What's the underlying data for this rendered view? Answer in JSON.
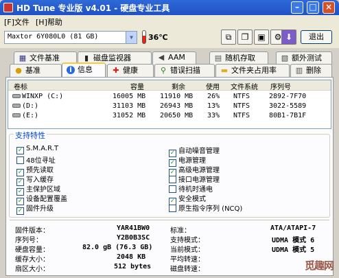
{
  "window": {
    "title": "HD Tune 专业版 v4.01 - 硬盘专业工具",
    "minimize": "–",
    "maximize": "□",
    "close": "×"
  },
  "menu": {
    "file": "[F]文件",
    "help": "[H]帮助"
  },
  "toolbar": {
    "drive": "Maxtor 6Y080L0 (81 GB)",
    "temperature": "36℃",
    "exit_label": "退出",
    "icons": [
      "copy-icon",
      "copy-text-icon",
      "save-icon",
      "options-icon",
      "download-icon"
    ]
  },
  "tabs_top": [
    {
      "label": "文件基准",
      "icon": "file-benchmark-icon",
      "glyph": "▦"
    },
    {
      "label": "磁盘监视器",
      "icon": "disk-monitor-icon",
      "glyph": "▮"
    },
    {
      "label": "AAM",
      "icon": "speaker-icon",
      "glyph": "◀"
    },
    {
      "label": "随机存取",
      "icon": "random-access-icon",
      "glyph": "▤"
    },
    {
      "label": "额外测试",
      "icon": "extra-tests-icon",
      "glyph": "▧"
    }
  ],
  "tabs_bottom": [
    {
      "label": "基准",
      "icon": "benchmark-icon",
      "glyph": "●"
    },
    {
      "label": "信息",
      "icon": "info-icon",
      "glyph": "i"
    },
    {
      "label": "健康",
      "icon": "health-icon",
      "glyph": "✚"
    },
    {
      "label": "错误扫描",
      "icon": "error-scan-icon",
      "glyph": "⚲"
    },
    {
      "label": "文件夹占用率",
      "icon": "folder-usage-icon",
      "glyph": "▬"
    },
    {
      "label": "删除",
      "icon": "erase-icon",
      "glyph": "▥"
    }
  ],
  "volumes": {
    "headers": [
      "卷标",
      "容量",
      "剩余",
      "使用",
      "文件系统",
      "序列号"
    ],
    "rows": [
      [
        "WINXP (C:)",
        "16005 MB",
        "11910 MB",
        "26%",
        "NTFS",
        "2892-7F70"
      ],
      [
        "(D:)",
        "31103 MB",
        "26943 MB",
        "13%",
        "NTFS",
        "3022-5589"
      ],
      [
        "(E:)",
        "31052 MB",
        "20650 MB",
        "33%",
        "NTFS",
        "80B1-7B1F"
      ]
    ]
  },
  "features": {
    "title": "支持特性",
    "left": [
      {
        "label": "S.M.A.R.T",
        "checked": true
      },
      {
        "label": "48位寻址",
        "checked": false
      },
      {
        "label": "预先读取",
        "checked": true
      },
      {
        "label": "写入缓存",
        "checked": true
      },
      {
        "label": "主保护区域",
        "checked": true
      },
      {
        "label": "设备配置覆盖",
        "checked": true
      },
      {
        "label": "固件升级",
        "checked": true
      }
    ],
    "right": [
      {
        "label": "自动噪音管理",
        "checked": true
      },
      {
        "label": "电源管理",
        "checked": true
      },
      {
        "label": "高级电源管理",
        "checked": true
      },
      {
        "label": "接口电源管理",
        "checked": false
      },
      {
        "label": "待机时通电",
        "checked": false
      },
      {
        "label": "安全模式",
        "checked": true
      },
      {
        "label": "原生指令序列 (NCQ)",
        "checked": false
      }
    ],
    "check_mark": "✓"
  },
  "details": {
    "left": [
      {
        "label": "固件版本：",
        "value": "YAR41BW0"
      },
      {
        "label": "序列号：",
        "value": "Y2B0B3SC"
      },
      {
        "label": "硬盘容量：",
        "value": "82.0 gB (76.3 GB)"
      },
      {
        "label": "缓存大小：",
        "value": "2048 KB"
      },
      {
        "label": "扇区大小：",
        "value": "512 bytes"
      }
    ],
    "right": [
      {
        "label": "标准：",
        "value": "ATA/ATAPI-7"
      },
      {
        "label": "支持模式：",
        "value": "UDMA 模式 6"
      },
      {
        "label": "当前模式：",
        "value": "UDMA 模式 5"
      },
      {
        "label": "平均转速：",
        "value": ""
      },
      {
        "label": "磁盘转速：",
        "value": ""
      }
    ]
  },
  "watermark": "觅趣网",
  "colors": {
    "titlebar": "#2f69d8",
    "feature_title": "#0046d5",
    "active_tab_highlight": "#ffc83c"
  }
}
